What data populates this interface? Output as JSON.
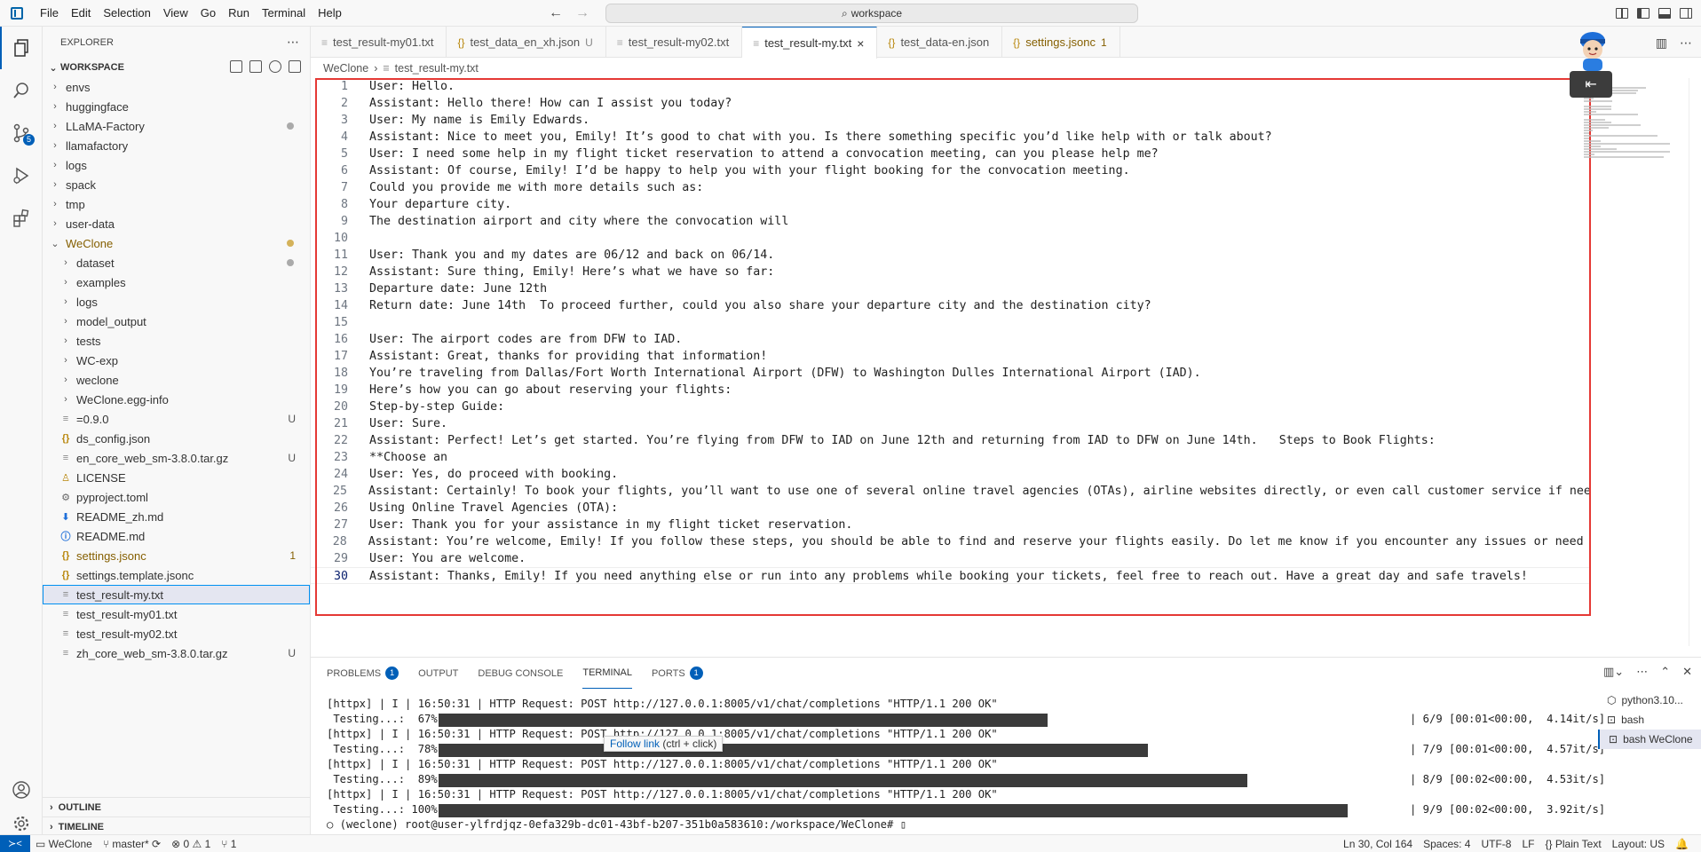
{
  "menu": [
    "File",
    "Edit",
    "Selection",
    "View",
    "Go",
    "Run",
    "Terminal",
    "Help"
  ],
  "search": {
    "label": "workspace"
  },
  "sidebar": {
    "title": "EXPLORER",
    "workspace_title": "WORKSPACE",
    "items": [
      {
        "label": "envs",
        "type": "folder",
        "indent": 1
      },
      {
        "label": "huggingface",
        "type": "folder",
        "indent": 1
      },
      {
        "label": "LLaMA-Factory",
        "type": "folder",
        "indent": 1,
        "deco": "dot"
      },
      {
        "label": "llamafactory",
        "type": "folder",
        "indent": 1
      },
      {
        "label": "logs",
        "type": "folder",
        "indent": 1
      },
      {
        "label": "spack",
        "type": "folder",
        "indent": 1
      },
      {
        "label": "tmp",
        "type": "folder",
        "indent": 1
      },
      {
        "label": "user-data",
        "type": "folder",
        "indent": 1
      },
      {
        "label": "WeClone",
        "type": "folder-open",
        "indent": 1,
        "deco": "dot-yellow",
        "color": "#855f00"
      },
      {
        "label": "dataset",
        "type": "folder",
        "indent": 2,
        "deco": "dot"
      },
      {
        "label": "examples",
        "type": "folder",
        "indent": 2
      },
      {
        "label": "logs",
        "type": "folder",
        "indent": 2
      },
      {
        "label": "model_output",
        "type": "folder",
        "indent": 2
      },
      {
        "label": "tests",
        "type": "folder",
        "indent": 2
      },
      {
        "label": "WC-exp",
        "type": "folder",
        "indent": 2
      },
      {
        "label": "weclone",
        "type": "folder",
        "indent": 2
      },
      {
        "label": "WeClone.egg-info",
        "type": "folder",
        "indent": 2
      },
      {
        "label": "=0.9.0",
        "type": "file",
        "icon": "≡",
        "indent": 2,
        "deco": "U"
      },
      {
        "label": "ds_config.json",
        "type": "file",
        "icon": "{}",
        "indent": 2
      },
      {
        "label": "en_core_web_sm-3.8.0.tar.gz",
        "type": "file",
        "icon": "≡",
        "indent": 2,
        "deco": "U"
      },
      {
        "label": "LICENSE",
        "type": "file",
        "icon": "♙",
        "indent": 2
      },
      {
        "label": "pyproject.toml",
        "type": "file",
        "icon": "⚙",
        "indent": 2
      },
      {
        "label": "README_zh.md",
        "type": "file",
        "icon": "⬇",
        "indent": 2
      },
      {
        "label": "README.md",
        "type": "file",
        "icon": "ⓘ",
        "indent": 2
      },
      {
        "label": "settings.jsonc",
        "type": "file",
        "icon": "{}",
        "indent": 2,
        "deco": "1",
        "color": "#855f00"
      },
      {
        "label": "settings.template.jsonc",
        "type": "file",
        "icon": "{}",
        "indent": 2
      },
      {
        "label": "test_result-my.txt",
        "type": "file",
        "icon": "≡",
        "indent": 2,
        "selected": true
      },
      {
        "label": "test_result-my01.txt",
        "type": "file",
        "icon": "≡",
        "indent": 2
      },
      {
        "label": "test_result-my02.txt",
        "type": "file",
        "icon": "≡",
        "indent": 2
      },
      {
        "label": "zh_core_web_sm-3.8.0.tar.gz",
        "type": "file",
        "icon": "≡",
        "indent": 2,
        "deco": "U"
      }
    ],
    "outline": "OUTLINE",
    "timeline": "TIMELINE"
  },
  "tabs": [
    {
      "label": "test_result-my01.txt",
      "icon": "≡",
      "mod": ""
    },
    {
      "label": "test_data_en_xh.json",
      "icon": "{}",
      "mod": "U"
    },
    {
      "label": "test_result-my02.txt",
      "icon": "≡",
      "mod": ""
    },
    {
      "label": "test_result-my.txt",
      "icon": "≡",
      "mod": "×",
      "active": true
    },
    {
      "label": "test_data-en.json",
      "icon": "{}",
      "mod": ""
    },
    {
      "label": "settings.jsonc",
      "icon": "{}",
      "mod": "1",
      "warn": true
    }
  ],
  "breadcrumb": [
    "WeClone",
    "test_result-my.txt"
  ],
  "code_lines": [
    "User: Hello.",
    "Assistant: Hello there! How can I assist you today?",
    "User: My name is Emily Edwards.",
    "Assistant: Nice to meet you, Emily! It’s good to chat with you. Is there something specific you’d like help with or talk about?",
    "User: I need some help in my flight ticket reservation to attend a convocation meeting, can you please help me?",
    "Assistant: Of course, Emily! I’d be happy to help you with your flight booking for the convocation meeting.",
    "Could you provide me with more details such as:",
    "Your departure city.",
    "The destination airport and city where the convocation will",
    "",
    "User: Thank you and my dates are 06/12 and back on 06/14.",
    "Assistant: Sure thing, Emily! Here’s what we have so far:",
    "Departure date: June 12th",
    "Return date: June 14th  To proceed further, could you also share your departure city and the destination city?",
    "",
    "User: The airport codes are from DFW to IAD.",
    "Assistant: Great, thanks for providing that information!",
    "You’re traveling from Dallas/Fort Worth International Airport (DFW) to Washington Dulles International Airport (IAD).",
    "Here’s how you can go about reserving your flights:",
    "Step-by-step Guide:",
    "User: Sure.",
    "Assistant: Perfect! Let’s get started. You’re flying from DFW to IAD on June 12th and returning from IAD to DFW on June 14th.   Steps to Book Flights:",
    "**Choose an",
    "User: Yes, do proceed with booking.",
    "Assistant: Certainly! To book your flights, you’ll want to use one of several online travel agencies (OTAs), airline websites directly, or even call customer service if needed.",
    "Using Online Travel Agencies (OTA):",
    "User: Thank you for your assistance in my flight ticket reservation.",
    "Assistant: You’re welcome, Emily! If you follow these steps, you should be able to find and reserve your flights easily. Do let me know if you encounter any issues or need furth",
    "User: You are welcome.",
    "Assistant: Thanks, Emily! If you need anything else or run into any problems while booking your tickets, feel free to reach out. Have a great day and safe travels!"
  ],
  "panel": {
    "tabs": [
      {
        "label": "PROBLEMS",
        "badge": "1"
      },
      {
        "label": "OUTPUT",
        "badge": ""
      },
      {
        "label": "DEBUG CONSOLE",
        "badge": ""
      },
      {
        "label": "TERMINAL",
        "badge": "",
        "active": true
      },
      {
        "label": "PORTS",
        "badge": "1"
      }
    ],
    "terminal": [
      {
        "text": "[httpx] | I | 16:50:31 | HTTP Request: POST http://127.0.0.1:8005/v1/chat/completions \"HTTP/1.1 200 OK\""
      },
      {
        "text": " Testing...:  67%|",
        "progress": 0.67,
        "right": "| 6/9 [00:01<00:00,  4.14it/s]"
      },
      {
        "text": "[httpx] | I | 16:50:31 | HTTP Request: POST http://127.0.0.1:8005/v1/chat/completions \"HTTP/1.1 200 OK\""
      },
      {
        "text": " Testing...:  78%|",
        "progress": 0.78,
        "right": "| 7/9 [00:01<00:00,  4.57it/s]"
      },
      {
        "text": "[httpx] | I | 16:50:31 | HTTP Request: POST http://127.0.0.1:8005/v1/chat/completions \"HTTP/1.1 200 OK\""
      },
      {
        "text": " Testing...:  89%|",
        "progress": 0.89,
        "right": "| 8/9 [00:02<00:00,  4.53it/s]"
      },
      {
        "text": "[httpx] | I | 16:50:31 | HTTP Request: POST http://127.0.0.1:8005/v1/chat/completions \"HTTP/1.1 200 OK\""
      },
      {
        "text": " Testing...: 100%|",
        "progress": 1.0,
        "right": "| 9/9 [00:02<00:00,  3.92it/s]"
      },
      {
        "text": "○ (weclone) root@user-ylfrdjqz-0efa329b-dc01-43bf-b207-351b0a583610:/workspace/WeClone# ▯"
      }
    ],
    "tooltip": {
      "link": "Follow link",
      "hint": "(ctrl + click)"
    },
    "terminals": [
      "python3.10...",
      "bash",
      "bash  WeClone"
    ]
  },
  "statusbar": {
    "remote": "≻<",
    "folder": "WeClone",
    "branch": "master*",
    "errors": "⊗ 0 ⚠ 1",
    "ports": "⑂ 1",
    "position": "Ln 30, Col 164",
    "spaces": "Spaces: 4",
    "encoding": "UTF-8",
    "eol": "LF",
    "language": "Plain Text",
    "layout": "Layout: US"
  }
}
